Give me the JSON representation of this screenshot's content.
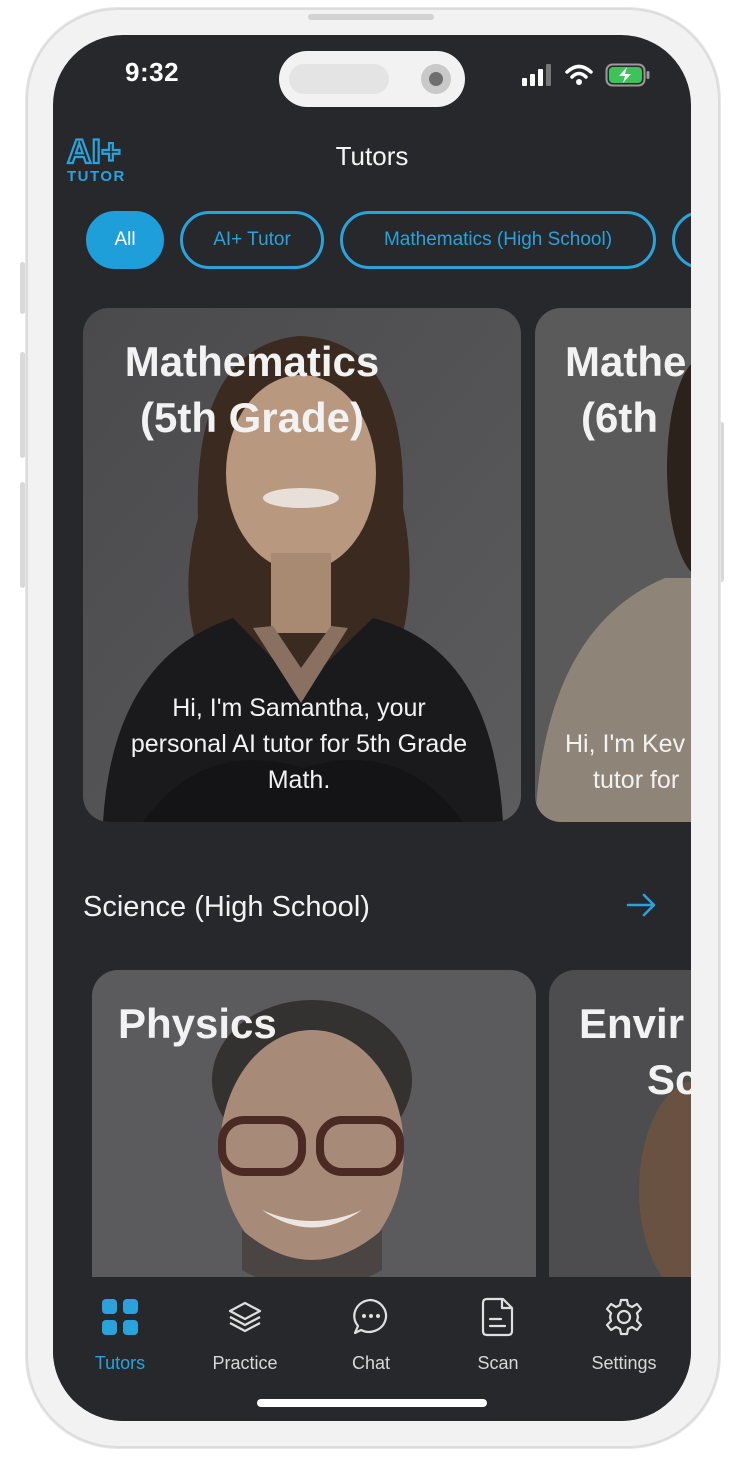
{
  "status_bar": {
    "time": "9:32"
  },
  "header": {
    "title": "Tutors",
    "logo_text": "AI+",
    "logo_sub": "TUTOR"
  },
  "chips": [
    {
      "label": "All",
      "active": true
    },
    {
      "label": "AI+ Tutor",
      "active": false
    },
    {
      "label": "Mathematics (High School)",
      "active": false
    }
  ],
  "featured_cards": [
    {
      "title_line1": "Mathematics",
      "title_line2": "(5th Grade)",
      "desc_line1": "Hi, I'm Samantha, your",
      "desc_line2": "personal AI tutor for 5th Grade",
      "desc_line3": "Math."
    },
    {
      "title_line1": "Mathe",
      "title_line2": "(6th",
      "desc_line1": "Hi, I'm Kev",
      "desc_line2": "tutor for"
    }
  ],
  "section": {
    "title": "Science (High School)",
    "cards": [
      {
        "title_line1": "Physics"
      },
      {
        "title_line1": "Envir",
        "title_line2": "Sc"
      }
    ]
  },
  "nav": [
    {
      "label": "Tutors",
      "icon": "grid-icon",
      "active": true
    },
    {
      "label": "Practice",
      "icon": "layers-icon",
      "active": false
    },
    {
      "label": "Chat",
      "icon": "chat-bubble-icon",
      "active": false
    },
    {
      "label": "Scan",
      "icon": "document-icon",
      "active": false
    },
    {
      "label": "Settings",
      "icon": "gear-icon",
      "active": false
    }
  ],
  "colors": {
    "accent": "#2aa3dc",
    "background": "#26282c",
    "text": "#f2f2f2"
  }
}
